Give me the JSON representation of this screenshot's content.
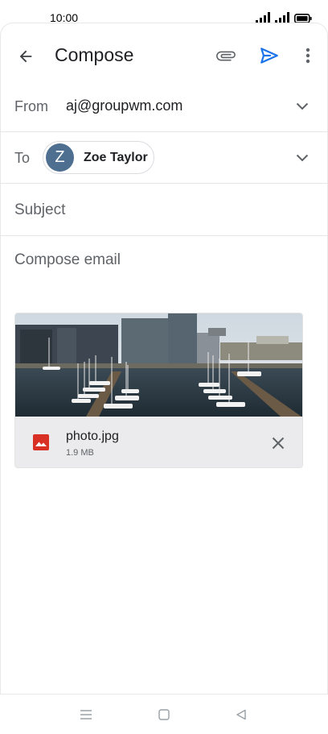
{
  "status": {
    "time": "10:00"
  },
  "toolbar": {
    "title": "Compose"
  },
  "from": {
    "label": "From",
    "value": "aj@groupwm.com"
  },
  "to": {
    "label": "To",
    "recipient_initial": "Z",
    "recipient_name": "Zoe Taylor"
  },
  "subject": {
    "placeholder": "Subject"
  },
  "body": {
    "placeholder": "Compose email"
  },
  "attachment": {
    "file_name": "photo.jpg",
    "file_size": "1.9 MB"
  },
  "colors": {
    "accent": "#1a73e8",
    "avatar": "#4e6f8f",
    "file_icon": "#d93025"
  }
}
